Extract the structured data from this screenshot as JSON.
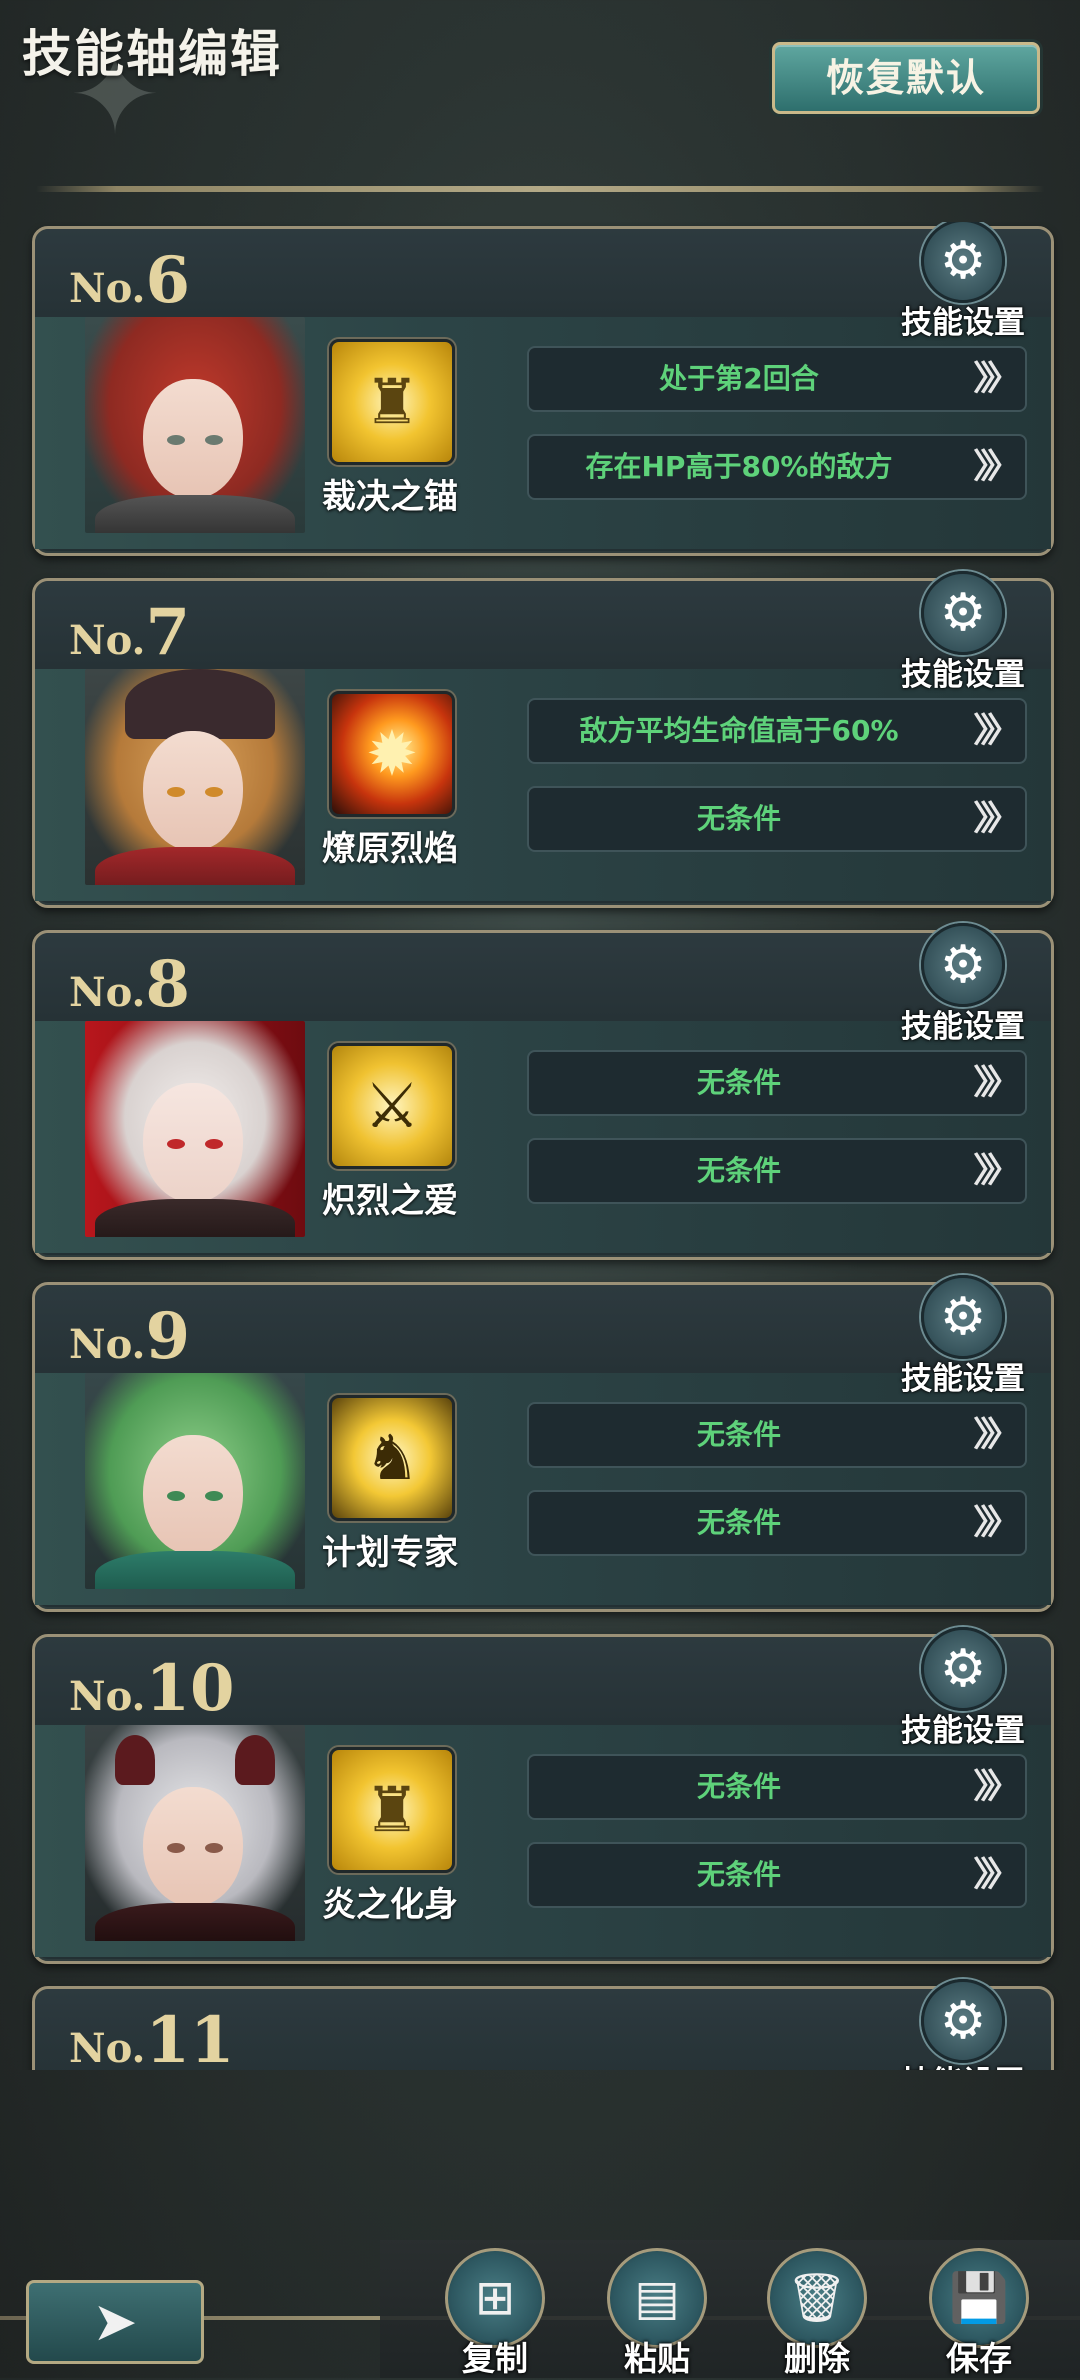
{
  "header": {
    "title": "技能轴编辑",
    "restore_label": "恢复默认"
  },
  "cards": [
    {
      "no_prefix": "No.",
      "number": "6",
      "settings_label": "技能设置",
      "skill_name": "裁决之锚",
      "skill_icon": "golden-knight-icon",
      "conditions": [
        "处于第2回合",
        "存在HP高于80%的敌方"
      ]
    },
    {
      "no_prefix": "No.",
      "number": "7",
      "settings_label": "技能设置",
      "skill_name": "燎原烈焰",
      "skill_icon": "fireball-icon",
      "conditions": [
        "敌方平均生命值高于60%",
        "无条件"
      ]
    },
    {
      "no_prefix": "No.",
      "number": "8",
      "settings_label": "技能设置",
      "skill_name": "炽烈之爱",
      "skill_icon": "crossed-swords-icon",
      "conditions": [
        "无条件",
        "无条件"
      ]
    },
    {
      "no_prefix": "No.",
      "number": "9",
      "settings_label": "技能设置",
      "skill_name": "计划专家",
      "skill_icon": "golden-warrior-icon",
      "conditions": [
        "无条件",
        "无条件"
      ]
    },
    {
      "no_prefix": "No.",
      "number": "10",
      "settings_label": "技能设置",
      "skill_name": "炎之化身",
      "skill_icon": "golden-knight-icon",
      "conditions": [
        "无条件",
        "无条件"
      ]
    },
    {
      "no_prefix": "No.",
      "number": "11",
      "settings_label": "技能设置"
    }
  ],
  "bottom": {
    "back_icon": "back-arrow-icon",
    "actions": [
      {
        "label": "复制",
        "icon": "copy-icon"
      },
      {
        "label": "粘贴",
        "icon": "paste-icon"
      },
      {
        "label": "删除",
        "icon": "trash-icon"
      },
      {
        "label": "保存",
        "icon": "save-icon"
      }
    ]
  },
  "colors": {
    "condition_text": "#5ed27a",
    "number_gold": "#e3d3a0",
    "restore_button": "#4f9891"
  }
}
